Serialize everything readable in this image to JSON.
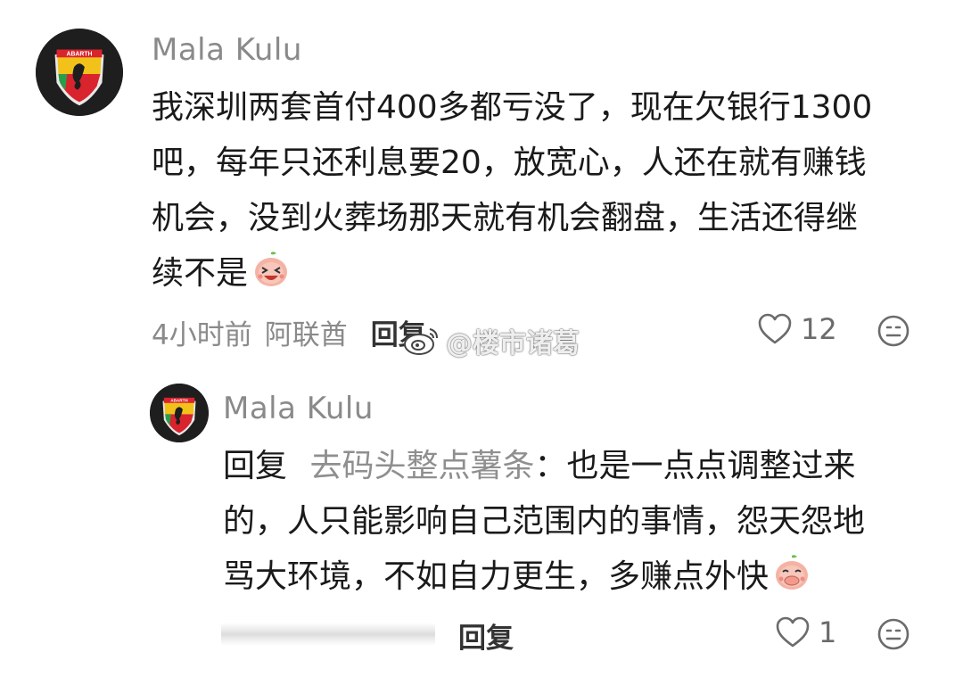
{
  "comment": {
    "username": "Mala Kulu",
    "avatar_badge_text": "ABARTH",
    "text": "我深圳两套首付400多都亏没了，现在欠银行1300吧，每年只还利息要20，放宽心，人还在就有赚钱机会，没到火葬场那天就有机会翻盘，生活还得继续不是",
    "lines": [
      "我深圳两套首付400多都亏没了，现在欠银行1300",
      "吧，每年只还利息要20，放宽心，人还在就有赚钱",
      "机会，没到火葬场那天就有机会翻盘，生活还得继",
      "续不是"
    ],
    "trailing_emoji": "laughing-peach-emoji",
    "time": "4小时前",
    "location": "阿联酋",
    "reply_label": "回复",
    "like_count": "12",
    "like_icon": "heart-outline-icon",
    "emoji_icon": "smiley-reaction-icon"
  },
  "reply": {
    "username": "Mala Kulu",
    "avatar_badge_text": "ABARTH",
    "prefix": "回复",
    "target": "去码头整点薯条",
    "colon": "：",
    "lines": [
      "也是一点点调整过来",
      "的，人只能影响自己范围内的事情，怨天怨地",
      "骂大环境，不如自力更生，多赚点外快"
    ],
    "trailing_emoji": "peach-covering-mouth-emoji",
    "reply_label": "回复",
    "like_count": "1",
    "like_icon": "heart-outline-icon",
    "emoji_icon": "smiley-reaction-icon"
  },
  "watermark": {
    "text": "@楼市诸葛",
    "icon": "weibo-logo-icon"
  },
  "colors": {
    "text_primary": "#1a1a1a",
    "text_secondary": "#8a8a8a",
    "avatar_bg": "#1e1e1e",
    "badge_yellow": "#f2c21a",
    "badge_red": "#d9232d",
    "badge_green": "#2a9d4a"
  }
}
